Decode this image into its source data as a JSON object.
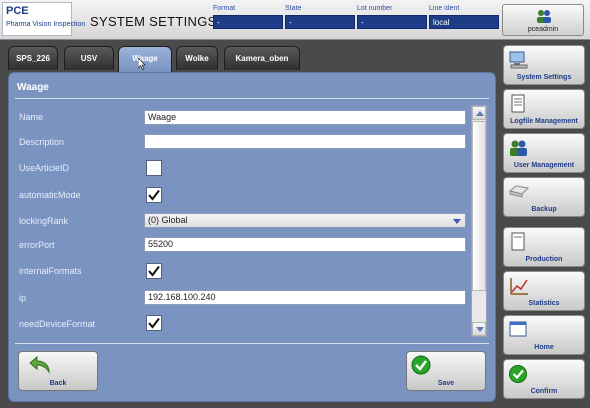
{
  "header": {
    "logo_line1": "PCE",
    "logo_line2": "Pharma Vision Inspection",
    "title": "SYSTEM SETTINGS",
    "fields": [
      {
        "label": "Format",
        "value": "-"
      },
      {
        "label": "State",
        "value": "-"
      },
      {
        "label": "Lot number",
        "value": "-"
      },
      {
        "label": "Line ident",
        "value": "local"
      }
    ],
    "user_label": "pceadmin"
  },
  "tabs": [
    {
      "label": "SPS_226",
      "active": false
    },
    {
      "label": "USV",
      "active": false
    },
    {
      "label": "Waage",
      "active": true
    },
    {
      "label": "Wolke",
      "active": false
    },
    {
      "label": "Kamera_oben",
      "active": false
    }
  ],
  "panel": {
    "title": "Waage",
    "rows": [
      {
        "label": "Name",
        "type": "text",
        "value": "Waage"
      },
      {
        "label": "Description",
        "type": "text",
        "value": ""
      },
      {
        "label": "UseArticleID",
        "type": "checkbox",
        "checked": false
      },
      {
        "label": "automaticMode",
        "type": "checkbox",
        "checked": true
      },
      {
        "label": "lockingRank",
        "type": "select",
        "value": "(0) Global"
      },
      {
        "label": "errorPort",
        "type": "text",
        "value": "55200"
      },
      {
        "label": "internalFormats",
        "type": "checkbox",
        "checked": true
      },
      {
        "label": "ip",
        "type": "text",
        "value": "192.168.100.240"
      },
      {
        "label": "needDeviceFormat",
        "type": "checkbox",
        "checked": true
      }
    ],
    "back_label": "Back",
    "save_label": "Save"
  },
  "sidebar": {
    "items": [
      {
        "label": "System Settings",
        "icon": "computer-icon"
      },
      {
        "label": "Logfile Management",
        "icon": "document-icon"
      },
      {
        "label": "User Management",
        "icon": "users-icon"
      },
      {
        "label": "Backup",
        "icon": "backup-drive-icon"
      },
      {
        "label": "Production",
        "icon": "document-icon"
      },
      {
        "label": "Statistics",
        "icon": "chart-icon"
      },
      {
        "label": "Home",
        "icon": "window-icon"
      },
      {
        "label": "Confirm",
        "icon": "checkmark-icon"
      }
    ]
  },
  "colors": {
    "panel_bg": "#7a93c0",
    "header_value_bg": "#1f3c88",
    "confirm_green": "#2aa52a"
  }
}
